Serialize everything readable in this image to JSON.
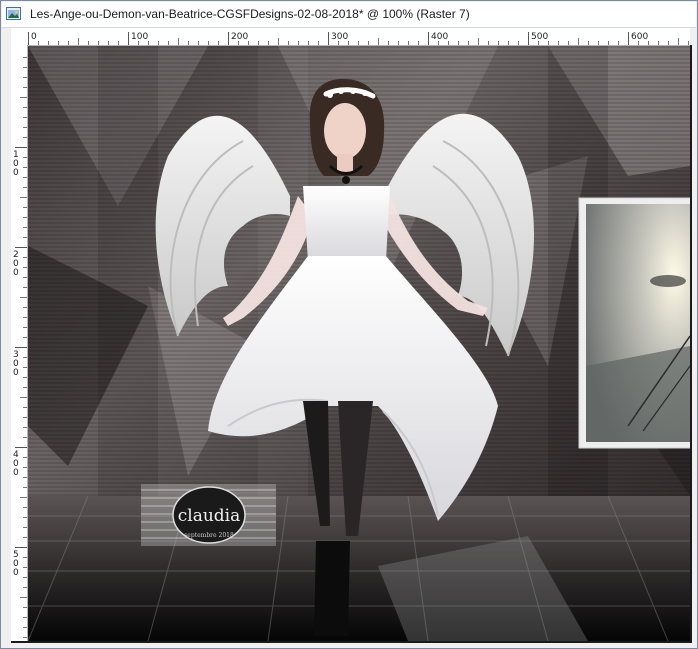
{
  "window": {
    "title": "Les-Ange-ou-Demon-van-Beatrice-CGSFDesigns-02-08-2018* @ 100% (Raster 7)"
  },
  "ruler": {
    "h_labels": [
      "0",
      "100",
      "200",
      "300",
      "400",
      "500",
      "600"
    ],
    "v_labels": [
      [
        "1",
        "0",
        "0"
      ],
      [
        "2",
        "0",
        "0"
      ],
      [
        "3",
        "0",
        "0"
      ],
      [
        "4",
        "0",
        "0"
      ],
      [
        "5",
        "0",
        "0"
      ]
    ]
  },
  "artwork": {
    "watermark_text": "claudia",
    "watermark_sub": "septembre 2018"
  },
  "colors": {
    "window_bg": "#f0f0f0",
    "ruler_bg": "#ffffff",
    "canvas_dark": "#2a2526"
  }
}
